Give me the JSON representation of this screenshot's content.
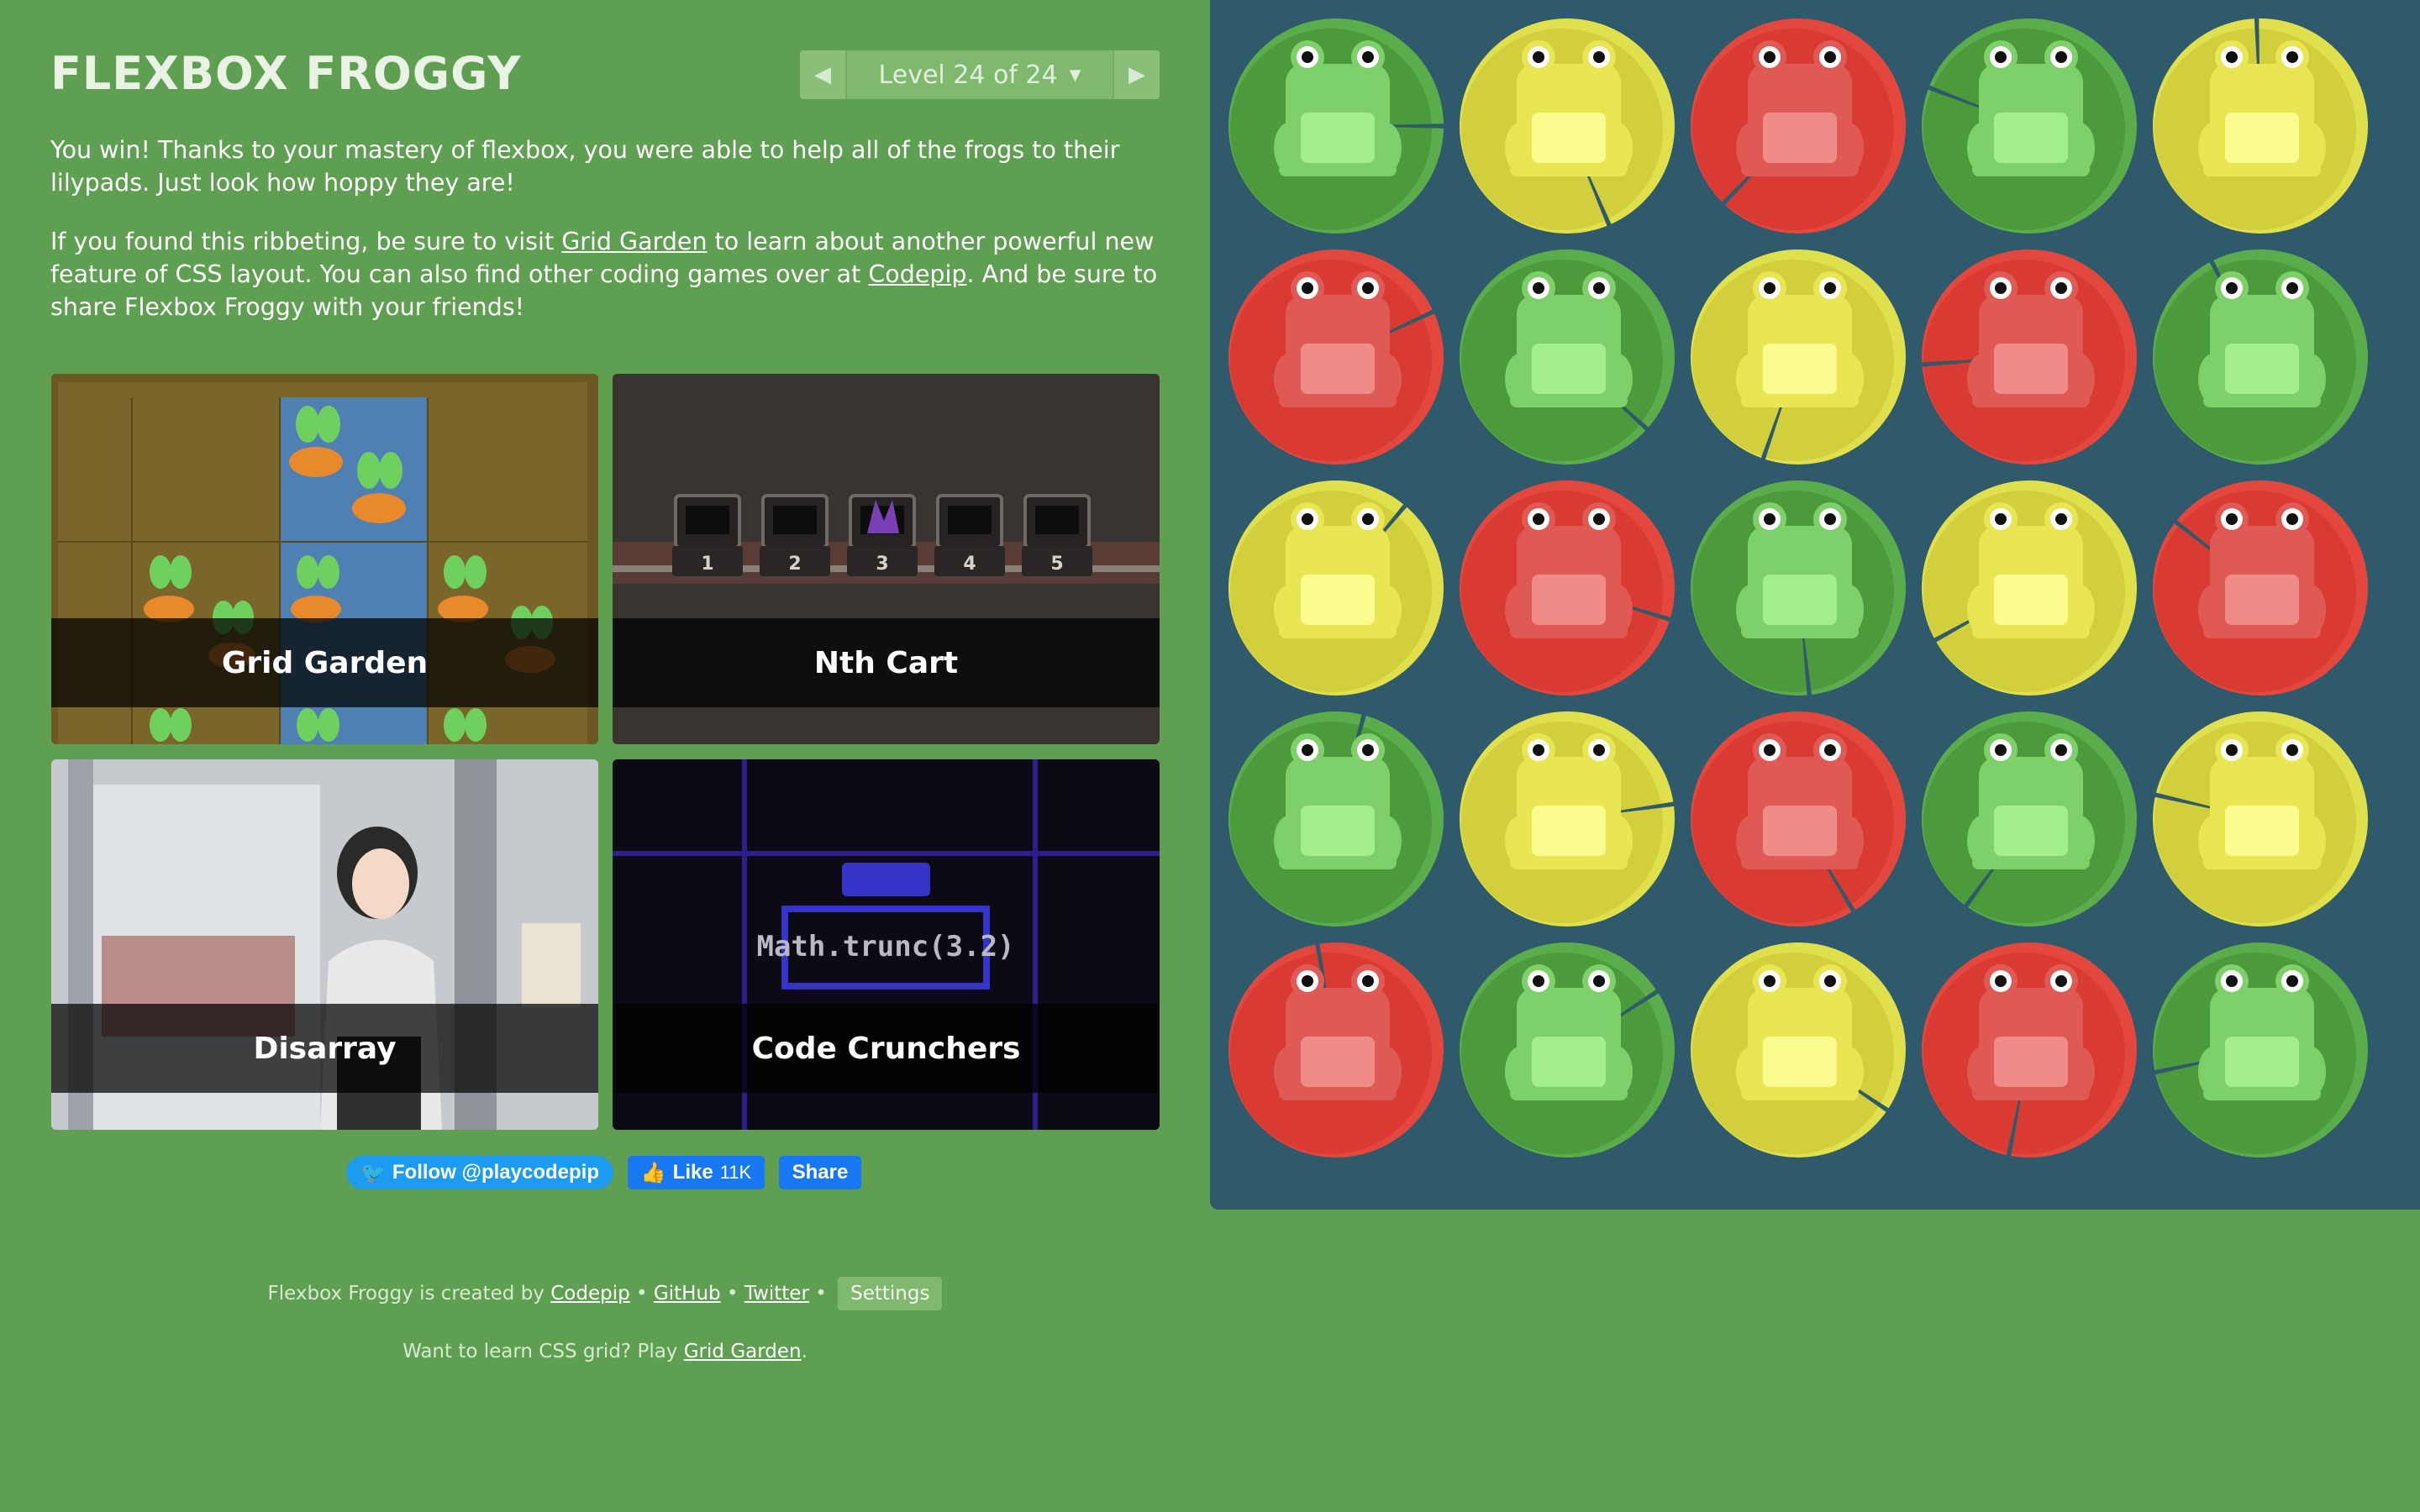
{
  "app": {
    "title": "FLEXBOX FROGGY"
  },
  "level_nav": {
    "label": "Level 24 of 24",
    "prev_icon": "triangle-left-icon",
    "next_icon": "triangle-right-icon"
  },
  "intro": {
    "win_text": "You win! Thanks to your mastery of flexbox, you were able to help all of the frogs to their lilypads. Just look how hoppy they are!",
    "p2_a": "If you found this ribbeting, be sure to visit ",
    "p2_link1": "Grid Garden",
    "p2_b": " to learn about another powerful new feature of CSS layout. You can also find other coding games over at ",
    "p2_link2": "Codepip",
    "p2_c": ". And be sure to share Flexbox Froggy with your friends!"
  },
  "games": [
    {
      "label": "Grid Garden"
    },
    {
      "label": "Nth Cart",
      "cart_numbers": [
        "1",
        "2",
        "3",
        "4",
        "5"
      ]
    },
    {
      "label": "Disarray"
    },
    {
      "label": "Code Crunchers",
      "code": "Math.trunc(3.2)"
    }
  ],
  "social": {
    "twitter": "Follow @playcodepip",
    "fb_like": "Like",
    "fb_like_count": "11K",
    "fb_share": "Share"
  },
  "footer": {
    "line1_prefix": "Flexbox Froggy is created by ",
    "codepip": "Codepip",
    "sep": " • ",
    "github": "GitHub",
    "twitter": "Twitter",
    "settings": "Settings",
    "line2_prefix": "Want to learn CSS grid? Play ",
    "line2_link": "Grid Garden",
    "line2_suffix": "."
  },
  "colors": {
    "background": "#5f9f51",
    "pond": "#2f5a6b",
    "green": "#4b9b3c",
    "yellow": "#d1d03c",
    "red": "#d93a31"
  },
  "pond": {
    "grid": [
      [
        "green",
        "yellow",
        "red",
        "green",
        "yellow"
      ],
      [
        "red",
        "green",
        "yellow",
        "red",
        "green"
      ],
      [
        "yellow",
        "red",
        "green",
        "yellow",
        "red"
      ],
      [
        "green",
        "yellow",
        "red",
        "green",
        "yellow"
      ],
      [
        "red",
        "green",
        "yellow",
        "red",
        "green"
      ]
    ]
  }
}
